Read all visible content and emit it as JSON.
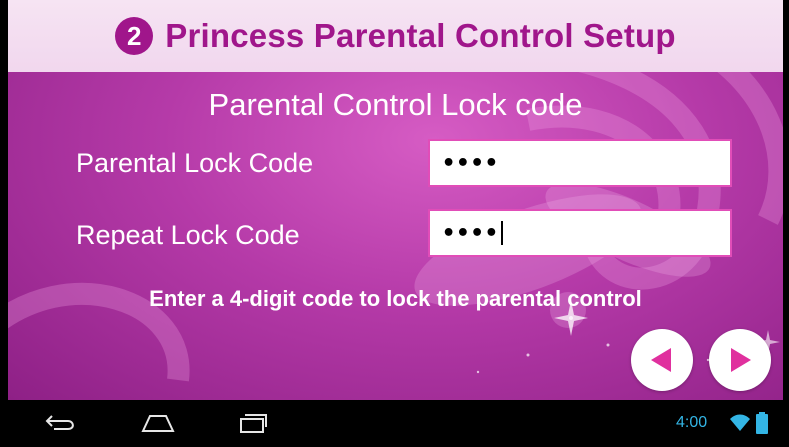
{
  "header": {
    "step_number": "2",
    "title": "Princess Parental Control Setup"
  },
  "subtitle": "Parental Control  Lock code",
  "form": {
    "lock_code_label": "Parental Lock Code",
    "lock_code_value": "••••",
    "repeat_code_label": "Repeat Lock Code",
    "repeat_code_value": "••••"
  },
  "hint": "Enter a 4-digit code to lock the parental control",
  "nav": {
    "back_icon": "triangle-left-icon",
    "next_icon": "triangle-right-icon"
  },
  "system_bar": {
    "time": "4:00",
    "icons": [
      "back-icon",
      "home-icon",
      "recent-apps-icon",
      "wifi-icon",
      "battery-icon"
    ]
  },
  "colors": {
    "accent": "#a0168b",
    "field_border": "#e14db8",
    "nav_arrow": "#e0309e",
    "status_text": "#33b5e5"
  }
}
